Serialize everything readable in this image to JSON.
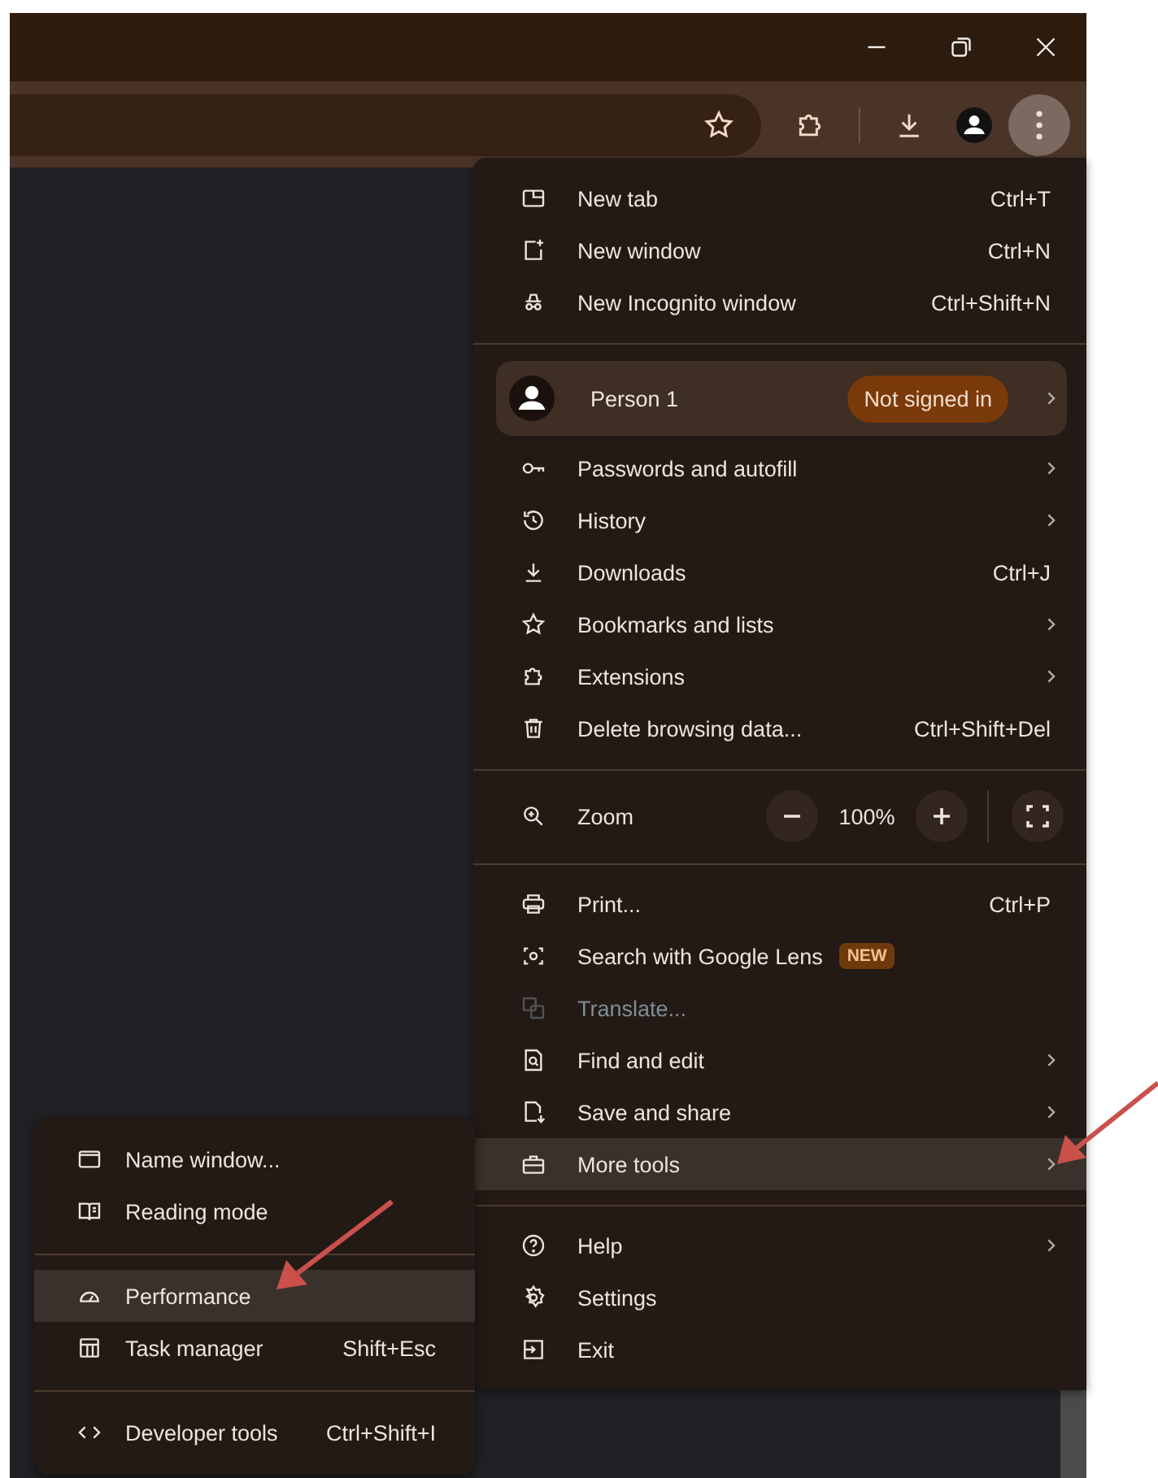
{
  "toolbar": {
    "menu_open": true
  },
  "menu": {
    "items": [
      {
        "kind": "item",
        "label": "New tab",
        "shortcut": "Ctrl+T",
        "submenu": false,
        "selected": false,
        "disabled": false
      },
      {
        "kind": "item",
        "label": "New window",
        "shortcut": "Ctrl+N",
        "submenu": false,
        "selected": false,
        "disabled": false
      },
      {
        "kind": "item",
        "label": "New Incognito window",
        "shortcut": "Ctrl+Shift+N",
        "submenu": false,
        "selected": false,
        "disabled": false
      },
      {
        "kind": "divider"
      },
      {
        "kind": "profile",
        "label": "Person 1",
        "badge": "Not signed in",
        "submenu": true
      },
      {
        "kind": "item",
        "label": "Passwords and autofill",
        "submenu": true,
        "selected": false,
        "disabled": false
      },
      {
        "kind": "item",
        "label": "History",
        "submenu": true,
        "selected": false,
        "disabled": false
      },
      {
        "kind": "item",
        "label": "Downloads",
        "shortcut": "Ctrl+J",
        "submenu": false,
        "selected": false,
        "disabled": false
      },
      {
        "kind": "item",
        "label": "Bookmarks and lists",
        "submenu": true,
        "selected": false,
        "disabled": false
      },
      {
        "kind": "item",
        "label": "Extensions",
        "submenu": true,
        "selected": false,
        "disabled": false
      },
      {
        "kind": "item",
        "label": "Delete browsing data...",
        "shortcut": "Ctrl+Shift+Del",
        "submenu": false,
        "selected": false,
        "disabled": false
      },
      {
        "kind": "divider"
      },
      {
        "kind": "zoom",
        "label": "Zoom",
        "value": "100%"
      },
      {
        "kind": "divider"
      },
      {
        "kind": "item",
        "label": "Print...",
        "shortcut": "Ctrl+P",
        "submenu": false,
        "selected": false,
        "disabled": false
      },
      {
        "kind": "item",
        "label": "Search with Google Lens",
        "badge": "NEW",
        "submenu": false,
        "selected": false,
        "disabled": false
      },
      {
        "kind": "item",
        "label": "Translate...",
        "submenu": false,
        "selected": false,
        "disabled": true
      },
      {
        "kind": "item",
        "label": "Find and edit",
        "submenu": true,
        "selected": false,
        "disabled": false
      },
      {
        "kind": "item",
        "label": "Save and share",
        "submenu": true,
        "selected": false,
        "disabled": false
      },
      {
        "kind": "item",
        "label": "More tools",
        "submenu": true,
        "selected": true,
        "disabled": false
      },
      {
        "kind": "divider"
      },
      {
        "kind": "item",
        "label": "Help",
        "submenu": true,
        "selected": false,
        "disabled": false
      },
      {
        "kind": "item",
        "label": "Settings",
        "submenu": false,
        "selected": false,
        "disabled": false
      },
      {
        "kind": "item",
        "label": "Exit",
        "submenu": false,
        "selected": false,
        "disabled": false
      }
    ]
  },
  "submenu": {
    "items": [
      {
        "kind": "item",
        "label": "Name window...",
        "selected": false
      },
      {
        "kind": "item",
        "label": "Reading mode",
        "selected": false
      },
      {
        "kind": "divider"
      },
      {
        "kind": "item",
        "label": "Performance",
        "selected": true
      },
      {
        "kind": "item",
        "label": "Task manager",
        "shortcut": "Shift+Esc",
        "selected": false
      },
      {
        "kind": "divider"
      },
      {
        "kind": "item",
        "label": "Developer tools",
        "shortcut": "Ctrl+Shift+I",
        "selected": false
      }
    ]
  }
}
